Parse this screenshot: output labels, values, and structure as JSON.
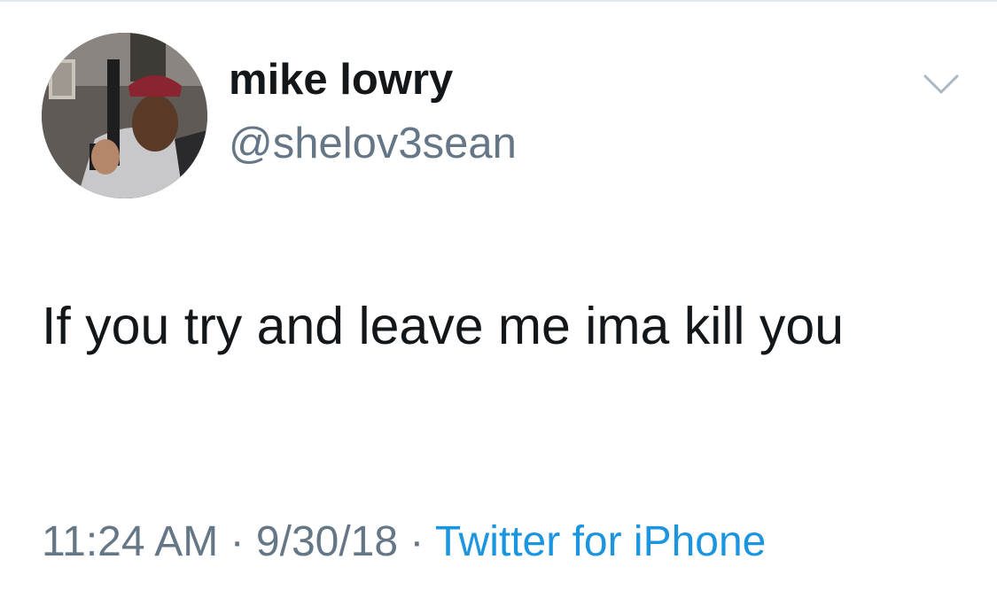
{
  "author": {
    "display_name": "mike lowry",
    "handle": "@shelov3sean"
  },
  "tweet": {
    "text": "If you try and leave me ima kill you",
    "time": "11:24 AM",
    "separator": "·",
    "date": "9/30/18",
    "source": "Twitter for iPhone"
  },
  "icons": {
    "menu": "chevron-down-icon",
    "avatar": "profile-photo"
  },
  "colors": {
    "name_text": "#14171a",
    "secondary_text": "#657786",
    "link": "#1b95e0",
    "icon": "#aab8c2",
    "border": "#e1e8ed"
  }
}
